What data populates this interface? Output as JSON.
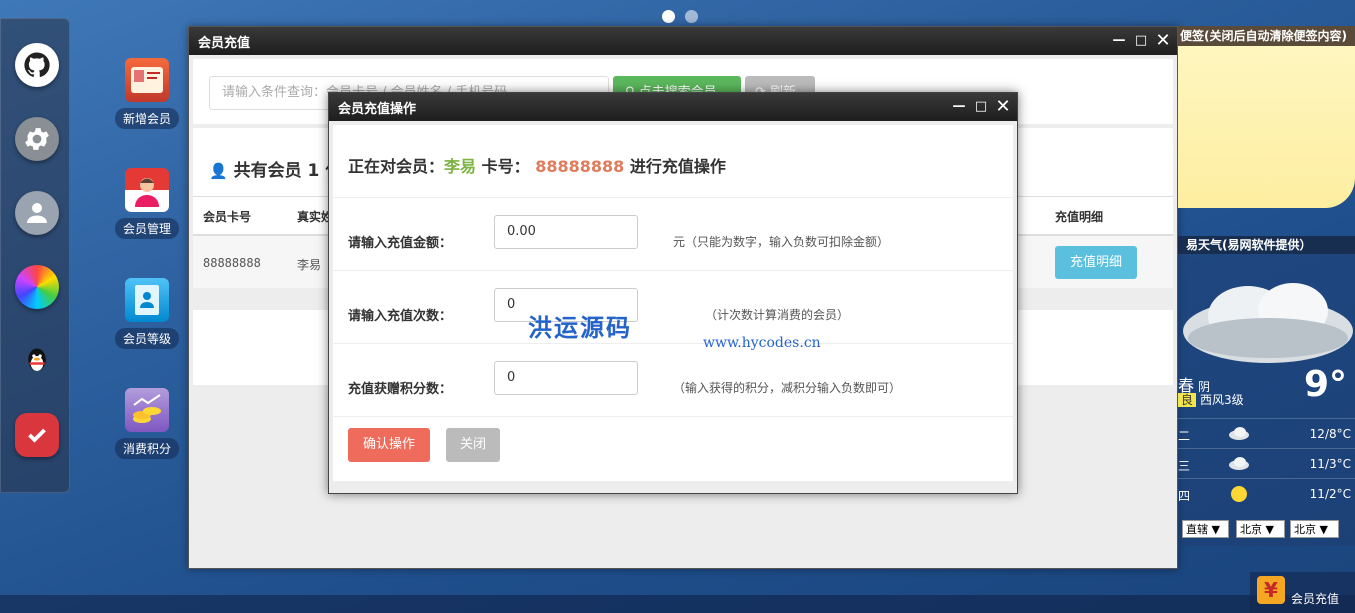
{
  "desktop": {
    "icons": [
      {
        "label": "新增会员"
      },
      {
        "label": "会员管理"
      },
      {
        "label": "会员等级"
      },
      {
        "label": "消费积分"
      }
    ]
  },
  "main_window": {
    "title": "会员充值",
    "search_placeholder": "请输入条件查询：会员卡号 / 会员姓名 / 手机号码",
    "search_button": "点击搜索会员",
    "refresh_button": "刷新",
    "count_title": "共有会员 1 位",
    "table": {
      "headers": [
        "会员卡号",
        "真实姓名",
        "充值明细"
      ],
      "rows": [
        {
          "card": "88888888",
          "name": "李易",
          "detail_button": "充值明细"
        }
      ]
    }
  },
  "modal": {
    "title": "会员充值操作",
    "heading_prefix": "正在对会员：",
    "member_name": "李易",
    "card_label": "卡号：",
    "card_number": "88888888",
    "heading_suffix": "进行充值操作",
    "fields": [
      {
        "label": "请输入充值金额：",
        "value": "0.00",
        "hint": "元（只能为数字，输入负数可扣除金额）"
      },
      {
        "label": "请输入充值次数：",
        "value": "0",
        "hint": "（计次数计算消费的会员）"
      },
      {
        "label": "充值获赠积分数：",
        "value": "0",
        "hint": "（输入获得的积分，减积分输入负数即可）"
      }
    ],
    "confirm_button": "确认操作",
    "close_button": "关闭",
    "watermark": "洪运源码",
    "watermark_url": "www.hycodes.cn"
  },
  "note_widget": {
    "title": "便签(关闭后自动清除便签内容)"
  },
  "weather_widget": {
    "title": "易天气(易网软件提供）",
    "city": "春",
    "condition": "阴",
    "temp": "9°",
    "air_quality": "良",
    "wind": "西风3级",
    "forecast": [
      {
        "day": "二",
        "temp": "12/8°C"
      },
      {
        "day": "三",
        "temp": "11/3°C"
      },
      {
        "day": "四",
        "temp": "11/2°C"
      }
    ],
    "selects": [
      "直辖",
      "北京",
      "北京"
    ]
  },
  "taskbar": {
    "active_item": "会员充值"
  }
}
